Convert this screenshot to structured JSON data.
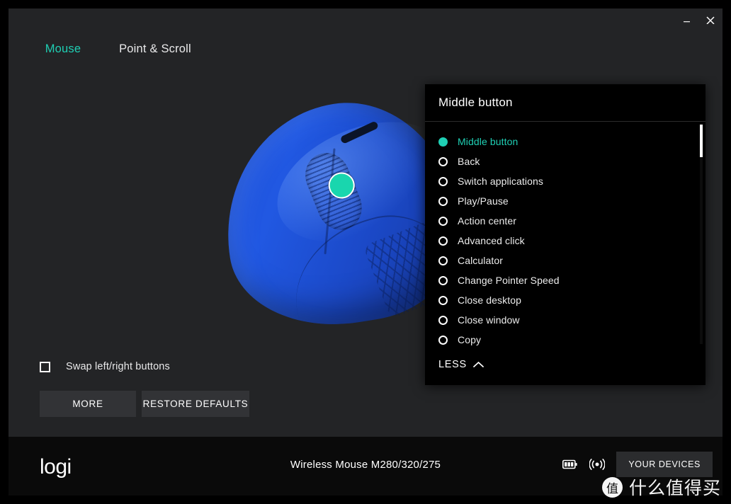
{
  "window": {
    "minimize_label": "minimize-icon",
    "close_label": "close-icon"
  },
  "tabs": [
    {
      "label": "Mouse",
      "active": true
    },
    {
      "label": "Point & Scroll",
      "active": false
    }
  ],
  "stage": {
    "hotspot_label": "middle-button-hotspot"
  },
  "controls": {
    "swap_checkbox_label": "Swap left/right buttons",
    "swap_checked": false,
    "more_label": "MORE",
    "restore_label": "RESTORE DEFAULTS"
  },
  "panel": {
    "title": "Middle button",
    "less_label": "LESS",
    "selected": "Middle button",
    "options": [
      {
        "label": "Middle button",
        "selected": true
      },
      {
        "label": "Back",
        "selected": false
      },
      {
        "label": "Switch applications",
        "selected": false
      },
      {
        "label": "Play/Pause",
        "selected": false
      },
      {
        "label": "Action center",
        "selected": false
      },
      {
        "label": "Advanced click",
        "selected": false
      },
      {
        "label": "Calculator",
        "selected": false
      },
      {
        "label": "Change Pointer Speed",
        "selected": false
      },
      {
        "label": "Close desktop",
        "selected": false
      },
      {
        "label": "Close window",
        "selected": false
      },
      {
        "label": "Copy",
        "selected": false
      }
    ]
  },
  "footer": {
    "brand": "logi",
    "device_name": "Wireless Mouse M280/320/275",
    "battery_icon": "battery-full-icon",
    "connection_icon": "wireless-signal-icon",
    "your_devices_label": "YOUR DEVICES"
  },
  "watermark": {
    "badge": "值",
    "text": "什么值得买"
  },
  "colors": {
    "accent": "#1fcfb4",
    "app_bg": "#232426",
    "panel_bg": "#000000",
    "footer_bg": "#0a0a0a",
    "button_bg": "#323336",
    "mouse_blue": "#1d4fd6"
  }
}
